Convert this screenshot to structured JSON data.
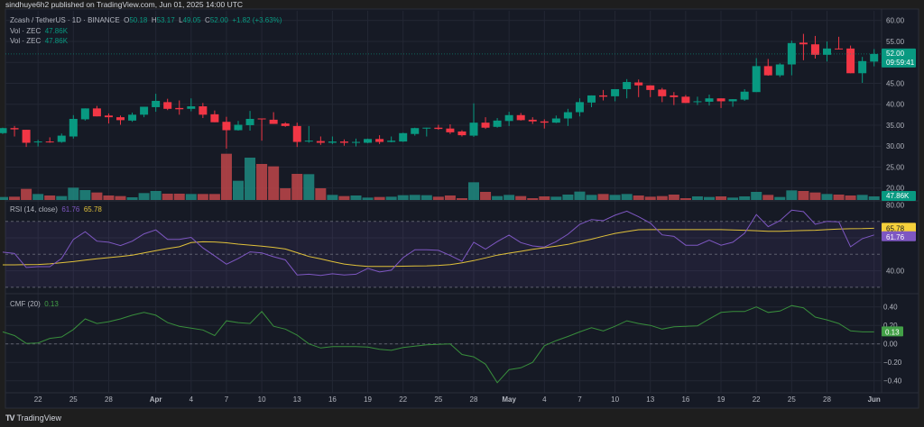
{
  "publish_line": "sindhuye6h2 published on TradingView.com, Jun 01, 2025 14:00 UTC",
  "symbol": {
    "title": "Zcash / TetherUS · 1D · BINANCE",
    "o_label": "O",
    "o": "50.18",
    "h_label": "H",
    "h": "53.17",
    "l_label": "L",
    "l": "49.05",
    "c_label": "C",
    "c": "52.00",
    "change": "+1.82 (+3.63%)"
  },
  "volume_legends": [
    {
      "label": "Vol · ZEC",
      "value": "47.86K"
    },
    {
      "label": "Vol · ZEC",
      "value": "47.86K"
    }
  ],
  "rsi_legend": {
    "label": "RSI (14, close)",
    "rsi": "61.76",
    "ma": "65.78"
  },
  "cmf_legend": {
    "label": "CMF (20)",
    "value": "0.13"
  },
  "price_tag": {
    "price": "52.00",
    "countdown": "09:59:41"
  },
  "volume_tag": "47.86K",
  "footer": {
    "logo": "TV",
    "brand": "TradingView"
  },
  "colors": {
    "up": "#089981",
    "down": "#f23645",
    "vol_up": "#1f8a80",
    "vol_down": "#c0464a",
    "rsi": "#7e57c2",
    "rsi_ma": "#e0c13a",
    "cmf": "#388e3c",
    "bg": "#161a25"
  },
  "chart_data": [
    {
      "type": "candlestick",
      "title": "Zcash / TetherUS · 1D · BINANCE",
      "ylim": [
        18,
        62
      ],
      "y_ticks": [
        "60.00",
        "55.00",
        "50.00",
        "45.00",
        "40.00",
        "35.00",
        "30.00",
        "25.00",
        "20.00"
      ],
      "y_tick_values": [
        60,
        55,
        50,
        45,
        40,
        35,
        30,
        25,
        20
      ],
      "x_ticks": [
        {
          "i": 3,
          "label": "22"
        },
        {
          "i": 6,
          "label": "25"
        },
        {
          "i": 9,
          "label": "28"
        },
        {
          "i": 13,
          "label": "Apr"
        },
        {
          "i": 16,
          "label": "4"
        },
        {
          "i": 19,
          "label": "7"
        },
        {
          "i": 22,
          "label": "10"
        },
        {
          "i": 25,
          "label": "13"
        },
        {
          "i": 28,
          "label": "16"
        },
        {
          "i": 31,
          "label": "19"
        },
        {
          "i": 34,
          "label": "22"
        },
        {
          "i": 37,
          "label": "25"
        },
        {
          "i": 40,
          "label": "28"
        },
        {
          "i": 43,
          "label": "May"
        },
        {
          "i": 46,
          "label": "4"
        },
        {
          "i": 49,
          "label": "7"
        },
        {
          "i": 52,
          "label": "10"
        },
        {
          "i": 55,
          "label": "13"
        },
        {
          "i": 58,
          "label": "16"
        },
        {
          "i": 61,
          "label": "19"
        },
        {
          "i": 64,
          "label": "22"
        },
        {
          "i": 67,
          "label": "25"
        },
        {
          "i": 70,
          "label": "28"
        },
        {
          "i": 74,
          "label": "Jun"
        }
      ],
      "ohlc": [
        [
          33.1,
          34.4,
          32.9,
          34.3
        ],
        [
          34.3,
          34.8,
          32.3,
          34.0
        ],
        [
          33.9,
          33.9,
          29.8,
          30.8
        ],
        [
          30.9,
          31.5,
          29.9,
          31.1
        ],
        [
          31.1,
          32.1,
          30.8,
          30.9
        ],
        [
          31.0,
          33.0,
          30.8,
          32.5
        ],
        [
          32.3,
          37.4,
          31.8,
          36.5
        ],
        [
          36.4,
          39.0,
          36.1,
          39.0
        ],
        [
          39.0,
          39.6,
          37.1,
          37.1
        ],
        [
          37.3,
          37.8,
          35.4,
          36.9
        ],
        [
          36.9,
          37.3,
          35.1,
          36.2
        ],
        [
          36.1,
          38.0,
          35.8,
          37.5
        ],
        [
          37.5,
          39.4,
          36.9,
          39.4
        ],
        [
          39.3,
          42.5,
          38.2,
          40.8
        ],
        [
          40.5,
          41.3,
          38.6,
          38.9
        ],
        [
          39.1,
          40.9,
          37.5,
          38.8
        ],
        [
          38.9,
          41.4,
          38.3,
          39.5
        ],
        [
          39.5,
          40.3,
          36.7,
          37.5
        ],
        [
          37.6,
          38.5,
          35.7,
          35.7
        ],
        [
          35.8,
          37.0,
          29.4,
          33.8
        ],
        [
          33.8,
          36.0,
          33.7,
          35.1
        ],
        [
          35.0,
          38.4,
          33.7,
          36.5
        ],
        [
          36.6,
          36.6,
          31.3,
          36.4
        ],
        [
          36.3,
          38.1,
          35.3,
          35.3
        ],
        [
          35.4,
          35.7,
          34.6,
          34.8
        ],
        [
          34.8,
          35.6,
          29.8,
          31.0
        ],
        [
          31.1,
          34.8,
          30.8,
          31.3
        ],
        [
          31.2,
          32.3,
          30.3,
          30.8
        ],
        [
          30.8,
          32.3,
          30.5,
          31.1
        ],
        [
          31.1,
          31.6,
          30.1,
          30.8
        ],
        [
          30.8,
          31.8,
          29.9,
          31.0
        ],
        [
          30.8,
          31.8,
          30.7,
          31.7
        ],
        [
          31.7,
          32.6,
          30.5,
          31.0
        ],
        [
          31.0,
          32.3,
          30.9,
          31.3
        ],
        [
          31.1,
          33.2,
          31.0,
          33.1
        ],
        [
          32.9,
          34.4,
          32.5,
          34.3
        ],
        [
          34.2,
          34.4,
          32.3,
          34.4
        ],
        [
          34.4,
          35.1,
          33.9,
          34.1
        ],
        [
          34.2,
          35.2,
          32.9,
          33.3
        ],
        [
          33.5,
          33.8,
          32.3,
          32.6
        ],
        [
          32.5,
          40.2,
          32.2,
          35.6
        ],
        [
          35.6,
          36.9,
          34.1,
          34.4
        ],
        [
          34.6,
          36.7,
          34.4,
          36.1
        ],
        [
          36.0,
          38.2,
          34.8,
          37.4
        ],
        [
          37.4,
          37.9,
          36.1,
          36.2
        ],
        [
          36.3,
          36.9,
          35.3,
          35.9
        ],
        [
          35.9,
          36.4,
          34.2,
          35.6
        ],
        [
          35.6,
          37.3,
          35.5,
          36.6
        ],
        [
          36.6,
          38.9,
          34.8,
          38.1
        ],
        [
          38.1,
          41.4,
          37.1,
          40.5
        ],
        [
          40.4,
          42.1,
          39.3,
          42.1
        ],
        [
          42.1,
          43.4,
          40.9,
          41.8
        ],
        [
          41.9,
          43.6,
          40.7,
          43.6
        ],
        [
          43.6,
          46.0,
          41.4,
          45.3
        ],
        [
          45.2,
          45.9,
          41.7,
          44.5
        ],
        [
          44.5,
          44.5,
          41.7,
          43.4
        ],
        [
          43.5,
          43.9,
          40.5,
          41.9
        ],
        [
          42.1,
          42.9,
          39.8,
          41.7
        ],
        [
          41.8,
          42.2,
          40.3,
          40.3
        ],
        [
          40.6,
          41.8,
          39.8,
          40.7
        ],
        [
          40.6,
          42.3,
          39.7,
          41.4
        ],
        [
          41.4,
          41.4,
          39.1,
          40.7
        ],
        [
          40.7,
          41.2,
          39.4,
          41.2
        ],
        [
          41.1,
          43.6,
          40.8,
          43.0
        ],
        [
          42.9,
          51.0,
          42.9,
          49.1
        ],
        [
          49.1,
          50.8,
          46.8,
          46.9
        ],
        [
          46.9,
          49.8,
          46.5,
          49.5
        ],
        [
          49.5,
          55.2,
          46.9,
          54.6
        ],
        [
          54.7,
          56.8,
          50.5,
          54.3
        ],
        [
          54.3,
          56.3,
          50.9,
          51.8
        ],
        [
          51.8,
          55.0,
          50.2,
          53.3
        ],
        [
          53.3,
          56.1,
          53.1,
          53.1
        ],
        [
          53.3,
          54.0,
          47.4,
          47.4
        ],
        [
          47.4,
          51.3,
          45.1,
          50.3
        ],
        [
          50.18,
          53.17,
          49.05,
          52.0
        ]
      ],
      "volume_k": [
        40,
        44,
        148,
        80,
        60,
        52,
        164,
        132,
        100,
        60,
        52,
        36,
        92,
        120,
        84,
        84,
        80,
        80,
        80,
        616,
        256,
        564,
        480,
        448,
        156,
        348,
        344,
        156,
        68,
        52,
        60,
        32,
        40,
        44,
        64,
        68,
        64,
        44,
        60,
        24,
        236,
        108,
        52,
        68,
        52,
        24,
        48,
        44,
        72,
        112,
        68,
        80,
        68,
        80,
        60,
        44,
        52,
        72,
        24,
        48,
        40,
        48,
        32,
        48,
        108,
        68,
        40,
        128,
        120,
        100,
        80,
        72,
        60,
        68,
        47.86
      ]
    },
    {
      "type": "line",
      "title": "RSI (14, close)",
      "ylim": [
        25,
        85
      ],
      "y_ticks": [
        "80.00",
        "40.00"
      ],
      "y_tick_values": [
        80,
        40
      ],
      "bands": [
        70,
        50,
        30
      ],
      "series": [
        {
          "name": "RSI",
          "values": [
            51.3,
            50.5,
            42,
            42.5,
            42.5,
            47.5,
            59,
            63.7,
            58,
            57.3,
            55.3,
            58,
            62.4,
            64.8,
            59,
            59,
            60.3,
            53.9,
            49,
            44,
            47.5,
            51.5,
            50.8,
            48.5,
            46.6,
            37.5,
            37.9,
            37.2,
            38.2,
            37.5,
            37.9,
            41.5,
            39.3,
            40.4,
            48,
            52.8,
            52.8,
            52.4,
            49.3,
            45.8,
            57.3,
            53.1,
            57.7,
            61.7,
            57.1,
            55.1,
            54.4,
            57.7,
            62.2,
            68.2,
            71.1,
            70.4,
            73.7,
            76.2,
            72.8,
            68.9,
            61.8,
            60.9,
            55.5,
            55.5,
            58.6,
            55.5,
            57.3,
            62.8,
            74.1,
            66.8,
            70.4,
            76.8,
            75.9,
            68.2,
            70,
            69.7,
            54.6,
            59.5,
            61.76
          ]
        },
        {
          "name": "RSI-based MA",
          "values": [
            43.6,
            43.6,
            43.7,
            43.8,
            44.2,
            44.9,
            45.6,
            46.5,
            47.3,
            48.0,
            48.7,
            49.5,
            50.8,
            52.2,
            53.5,
            54.6,
            57.1,
            57.6,
            57.5,
            57.0,
            56.2,
            55.6,
            55.0,
            54.2,
            53.2,
            51.0,
            48.7,
            47.2,
            45.6,
            44.1,
            43.3,
            42.7,
            42.7,
            42.7,
            42.8,
            42.9,
            43.0,
            43.3,
            43.7,
            44.8,
            46.2,
            47.8,
            49.5,
            50.7,
            51.8,
            53.0,
            54.0,
            55.0,
            56.0,
            57.7,
            59.2,
            61.0,
            62.7,
            63.8,
            64.9,
            65.0,
            65.0,
            65.0,
            65.0,
            65.0,
            65.0,
            65.0,
            64.8,
            64.6,
            64.3,
            64.0,
            64.0,
            64.2,
            64.4,
            64.6,
            65.0,
            65.3,
            65.5,
            65.6,
            65.78
          ]
        }
      ]
    },
    {
      "type": "line",
      "title": "CMF (20)",
      "ylim": [
        -0.5,
        0.5
      ],
      "y_ticks": [
        "0.40",
        "0.20",
        "0.00",
        "−0.20",
        "−0.40"
      ],
      "y_tick_values": [
        0.4,
        0.2,
        0,
        -0.2,
        -0.4
      ],
      "series": [
        {
          "name": "CMF",
          "values": [
            0.13,
            0.09,
            0.005,
            0.01,
            0.06,
            0.075,
            0.155,
            0.27,
            0.22,
            0.24,
            0.27,
            0.31,
            0.34,
            0.31,
            0.23,
            0.19,
            0.17,
            0.15,
            0.09,
            0.25,
            0.23,
            0.22,
            0.35,
            0.19,
            0.16,
            0.095,
            0,
            -0.045,
            -0.03,
            -0.03,
            -0.03,
            -0.035,
            -0.06,
            -0.07,
            -0.04,
            -0.025,
            -0.01,
            -0.005,
            0,
            -0.115,
            -0.14,
            -0.22,
            -0.42,
            -0.28,
            -0.26,
            -0.2,
            -0.02,
            0.035,
            0.08,
            0.13,
            0.175,
            0.14,
            0.19,
            0.25,
            0.22,
            0.2,
            0.16,
            0.185,
            0.19,
            0.195,
            0.27,
            0.34,
            0.35,
            0.35,
            0.4,
            0.34,
            0.355,
            0.415,
            0.39,
            0.29,
            0.26,
            0.22,
            0.14,
            0.13,
            0.13
          ]
        }
      ]
    }
  ]
}
